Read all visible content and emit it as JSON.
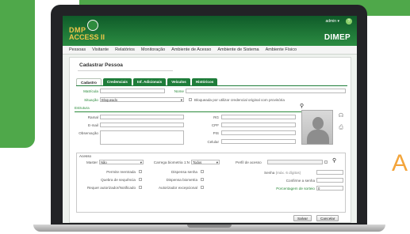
{
  "app": {
    "logo_line1": "DMP",
    "logo_line2": "ACCESS II",
    "user_menu": "admin ▾",
    "help_icon": "?",
    "brand": "DIMEP"
  },
  "menu": [
    "Pessoas",
    "Visitante",
    "Relatórios",
    "Monitoração",
    "Ambiente de Acesso",
    "Ambiente de Sistema",
    "Ambiente Físico"
  ],
  "page": {
    "title": "Cadastrar Pessoa",
    "tabs": [
      "Cadastro",
      "Credenciais",
      "Inf. Adicionais",
      "Veículos",
      "Históricos"
    ]
  },
  "form": {
    "matricula_label": "Matrícula",
    "nome_label": "Nome",
    "situacao_label": "Situação",
    "situacao_value": "Bloqueado",
    "bloqueada_text": "Bloqueada por utilizar credencial original com provisória",
    "estrutura_label": "Estrutura",
    "ramal_label": "Ramal",
    "email_label": "E-mail",
    "observacao_label": "Observação",
    "rg_label": "RG",
    "cpf_label": "CPF",
    "pis_label": "PIS",
    "celular_label": "Celular"
  },
  "acesso": {
    "legend": "Acesso",
    "master_label": "Master",
    "master_value": "Não",
    "carrega_label": "Carrega biometria 1:N",
    "carrega_value": "Todos",
    "perfil_label": "Perfil de acesso",
    "permite_reentrada": "Permite reentrada",
    "dispensa_senha": "Dispensa senha",
    "quebra_sequencia": "Quebra de sequência",
    "dispensa_biometria": "Dispensa biometria",
    "requer_autorizador": "Requer autorizador/Notificado",
    "autorizador_excepcional": "Autorizador excepcional",
    "senha_label": "Senha",
    "senha_hint": "(máx. 6 dígitos)",
    "confirme_label": "Confirme a senha",
    "porcentagem_label": "Porcentagem de sorteio",
    "porcentagem_value": "0"
  },
  "buttons": {
    "save": "Salvar",
    "cancel": "Cancelar"
  },
  "decor": {
    "orange_letter": "A"
  },
  "colors": {
    "brand_green": "#4fa84a",
    "header_dark_green": "#0f5b29",
    "tab_green": "#1f7d3a",
    "accent_orange": "#f3a43a",
    "logo_gold": "#f0c64a"
  }
}
